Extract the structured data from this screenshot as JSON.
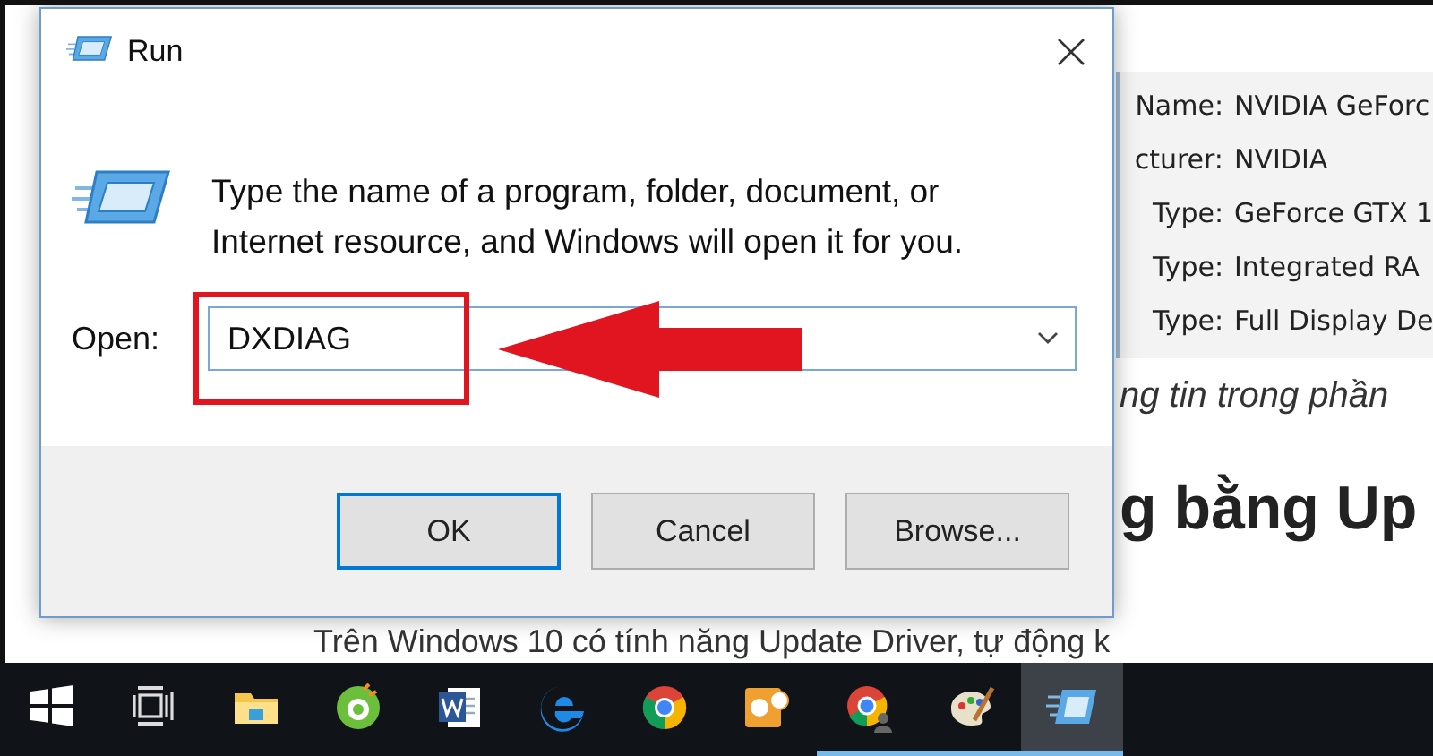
{
  "background_article": {
    "info_rows": [
      {
        "label": "Name:",
        "value": "NVIDIA GeForc"
      },
      {
        "label": "cturer:",
        "value": "NVIDIA"
      },
      {
        "label": "Type:",
        "value": "GeForce GTX 1"
      },
      {
        "label": "Type:",
        "value": "Integrated RA"
      },
      {
        "label": "Type:",
        "value": "Full Display De"
      }
    ],
    "caption": "ng tin trong phần",
    "heading": "g bằng Up",
    "paragraph": "Trên Windows 10 có tính năng Update Driver, tự động k"
  },
  "dialog": {
    "title": "Run",
    "description": "Type the name of a program, folder, document, or Internet resource, and Windows will open it for you.",
    "open_label": "Open:",
    "open_value": "DXDIAG",
    "buttons": [
      {
        "label": "OK",
        "default": true
      },
      {
        "label": "Cancel",
        "default": false
      },
      {
        "label": "Browse...",
        "default": false
      }
    ]
  },
  "taskbar": {
    "items": [
      {
        "kind": "start",
        "running": false,
        "active": false
      },
      {
        "kind": "task-view",
        "running": false,
        "active": false
      },
      {
        "kind": "folder",
        "running": false,
        "active": false
      },
      {
        "kind": "round-browser",
        "running": false,
        "active": false
      },
      {
        "kind": "word",
        "running": false,
        "active": false
      },
      {
        "kind": "edge",
        "running": false,
        "active": false
      },
      {
        "kind": "chrome",
        "running": false,
        "active": false
      },
      {
        "kind": "mail",
        "running": false,
        "active": false
      },
      {
        "kind": "chrome-user",
        "running": true,
        "active": false
      },
      {
        "kind": "paint",
        "running": true,
        "active": false
      },
      {
        "kind": "run",
        "running": true,
        "active": true
      }
    ]
  }
}
